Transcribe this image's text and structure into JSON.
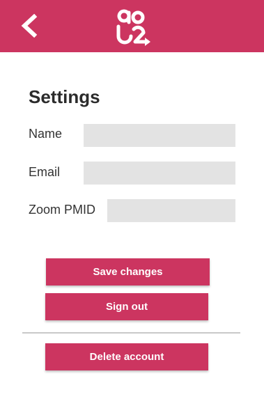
{
  "header": {
    "back_icon": "chevron-left-icon",
    "logo_icon": "go2-logo-icon",
    "logo_text": "go2",
    "background_color": "#cc3560"
  },
  "settings": {
    "title": "Settings",
    "fields": {
      "name": {
        "label": "Name",
        "value": "",
        "placeholder": ""
      },
      "email": {
        "label": "Email",
        "value": "",
        "placeholder": ""
      },
      "zoom_pmid": {
        "label": "Zoom PMID",
        "value": "",
        "placeholder": ""
      }
    }
  },
  "actions": {
    "save_label": "Save changes",
    "signout_label": "Sign out",
    "delete_label": "Delete account",
    "button_color": "#cc3560"
  }
}
